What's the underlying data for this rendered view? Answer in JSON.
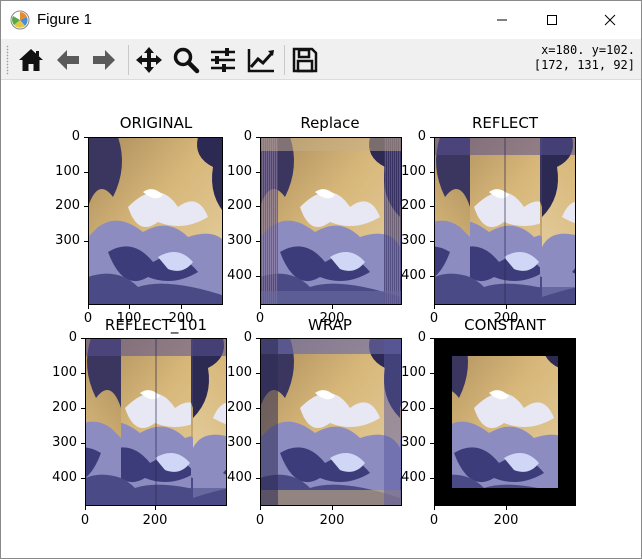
{
  "window": {
    "title": "Figure 1"
  },
  "toolbar": {
    "tools": [
      {
        "name": "home-icon",
        "tooltip": "Reset original view"
      },
      {
        "name": "back-arrow-icon",
        "tooltip": "Back to previous view"
      },
      {
        "name": "forward-arrow-icon",
        "tooltip": "Forward to next view"
      },
      {
        "name": "pan-icon",
        "tooltip": "Pan axes"
      },
      {
        "name": "zoom-icon",
        "tooltip": "Zoom to rectangle"
      },
      {
        "name": "subplots-icon",
        "tooltip": "Configure subplots"
      },
      {
        "name": "edit-axis-icon",
        "tooltip": "Edit axis"
      },
      {
        "name": "save-icon",
        "tooltip": "Save the figure"
      }
    ],
    "coords_line1": "x=180. y=102.",
    "coords_line2": "[172, 131, 92]"
  },
  "subplots": [
    {
      "title": "ORIGINAL",
      "yticks": [
        "0",
        "100",
        "200",
        "300"
      ],
      "xticks": [
        "0",
        "100",
        "200"
      ],
      "border": "none"
    },
    {
      "title": "Replace",
      "yticks": [
        "0",
        "100",
        "200",
        "300",
        "400"
      ],
      "xticks": [
        "0",
        "200"
      ],
      "border": "replicate"
    },
    {
      "title": "REFLECT",
      "yticks": [
        "0",
        "100",
        "200",
        "300",
        "400"
      ],
      "xticks": [
        "0",
        "200"
      ],
      "border": "reflect"
    },
    {
      "title": "REFLECT_101",
      "yticks": [
        "0",
        "100",
        "200",
        "300",
        "400"
      ],
      "xticks": [
        "0",
        "200"
      ],
      "border": "reflect101"
    },
    {
      "title": "WRAP",
      "yticks": [
        "0",
        "100",
        "200",
        "300",
        "400"
      ],
      "xticks": [
        "0",
        "200"
      ],
      "border": "wrap"
    },
    {
      "title": "CONSTANT",
      "yticks": [
        "0",
        "100",
        "200",
        "300",
        "400"
      ],
      "xticks": [
        "0",
        "200"
      ],
      "border": "constant"
    }
  ],
  "colors": {
    "sky": "#bfae8c",
    "cloud_dark": "#2c2a52",
    "cloud_mid": "#7b7bb4",
    "cloud_light": "#e8e8f4",
    "constant_border": "#000000"
  }
}
